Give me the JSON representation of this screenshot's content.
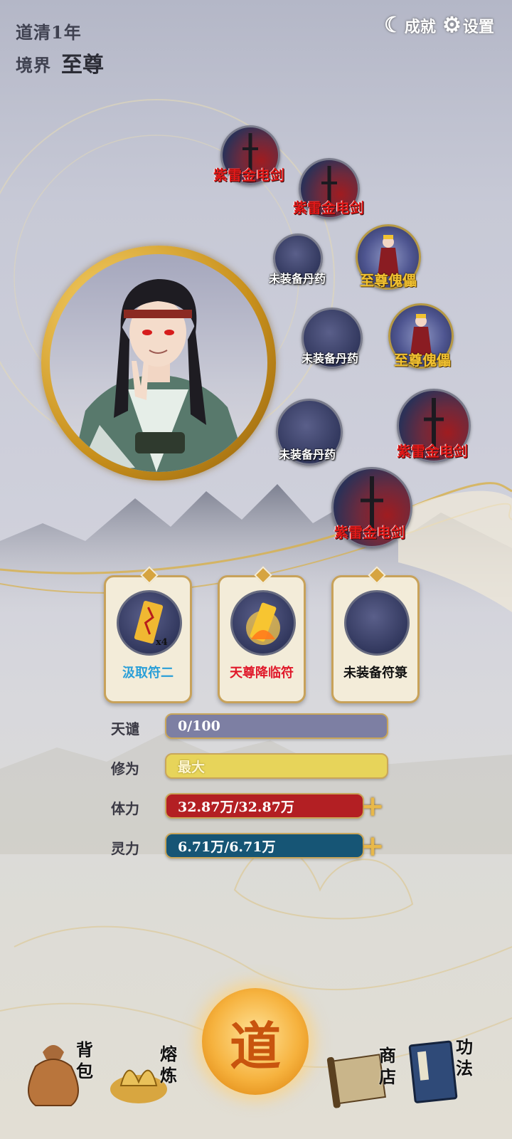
{
  "header": {
    "dao_year": "道清1年",
    "realm_label": "境界",
    "realm_value": "至尊",
    "achievements_label": "成就",
    "settings_label": "设置"
  },
  "equipment_slots": [
    {
      "label": "紫雷金电剑",
      "kind": "sword"
    },
    {
      "label": "紫雷金电剑",
      "kind": "sword"
    },
    {
      "label": "未装备丹药",
      "kind": "empty"
    },
    {
      "label": "至尊傀儡",
      "kind": "puppet"
    },
    {
      "label": "未装备丹药",
      "kind": "empty"
    },
    {
      "label": "至尊傀儡",
      "kind": "puppet"
    },
    {
      "label": "未装备丹药",
      "kind": "empty"
    },
    {
      "label": "紫雷金电剑",
      "kind": "sword"
    },
    {
      "label": "紫雷金电剑",
      "kind": "sword"
    }
  ],
  "talismans": [
    {
      "name": "汲取符二",
      "count": "x4",
      "color": "#2a9fd8"
    },
    {
      "name": "天尊降临符",
      "count": "",
      "color": "#e0182a"
    },
    {
      "name": "未装备符箓",
      "count": "",
      "color": "#111111"
    }
  ],
  "stats": {
    "tianjie": {
      "label": "天谴",
      "value": "0/100"
    },
    "xiuwei": {
      "label": "修为",
      "value": "最大"
    },
    "tili": {
      "label": "体力",
      "value": "32.87万/32.87万",
      "plus": "+"
    },
    "lingli": {
      "label": "灵力",
      "value": "6.71万/6.71万",
      "plus": "+"
    }
  },
  "nav": {
    "bag": "背包",
    "forge": "熔炼",
    "dao": "道",
    "shop": "商店",
    "skills": "功法"
  },
  "colors": {
    "tianjie_bar": "#7d7fa3",
    "xiuwei_bar": "#e7d45a",
    "tili_bar": "#b31f23",
    "lingli_bar": "#165575"
  }
}
